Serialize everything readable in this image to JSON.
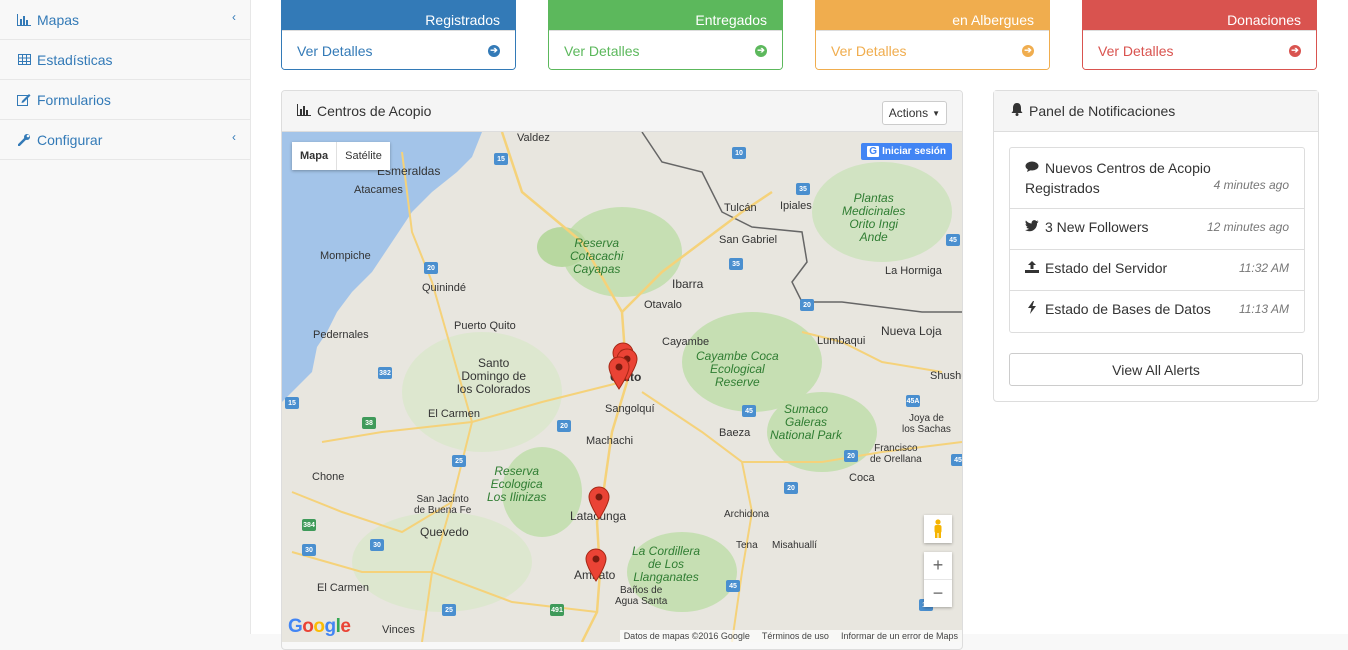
{
  "sidebar": {
    "items": [
      {
        "label": "Mapas",
        "icon": "bar-chart-icon",
        "has_submenu": true
      },
      {
        "label": "Estadísticas",
        "icon": "table-icon",
        "has_submenu": false
      },
      {
        "label": "Formularios",
        "icon": "edit-icon",
        "has_submenu": false
      },
      {
        "label": "Configurar",
        "icon": "wrench-icon",
        "has_submenu": true
      }
    ]
  },
  "stats": [
    {
      "title": "Registrados",
      "link": "Ver Detalles",
      "color": "#337ab7"
    },
    {
      "title": "Entregados",
      "link": "Ver Detalles",
      "color": "#5cb85c"
    },
    {
      "title": "en Albergues",
      "link": "Ver Detalles",
      "color": "#f0ad4e"
    },
    {
      "title": "Donaciones",
      "link": "Ver Detalles",
      "color": "#d9534f"
    }
  ],
  "map_panel": {
    "title": "Centros de Acopio",
    "actions_label": "Actions",
    "map_types": [
      "Mapa",
      "Satélite"
    ],
    "signin_label": "Iniciar sesión",
    "attribution": [
      "Datos de mapas ©2016 Google",
      "Términos de uso",
      "Informar de un error de Maps"
    ],
    "logo": "Google",
    "labels": {
      "valdez": "Valdez",
      "esmeraldas": "Esmeraldas",
      "atacames": "Atacames",
      "mompiche": "Mompiche",
      "quininde": "Quinindé",
      "puerto_quito": "Puerto Quito",
      "pedernales": "Pedernales",
      "santo_domingo": "Santo\nDomingo de\nlos Colorados",
      "el_carmen_n": "El Carmen",
      "chone": "Chone",
      "san_jacinto": "San Jacinto\nde Buena Fe",
      "quevedo": "Quevedo",
      "el_carmen_s": "El Carmen",
      "vinces": "Vinces",
      "ibarra": "Ibarra",
      "otavalo": "Otavalo",
      "cayambe": "Cayambe",
      "quito": "Quito",
      "sangolqui": "Sangolquí",
      "machachi": "Machachi",
      "latacunga": "Latacunga",
      "ambato": "Ambato",
      "banos": "Baños de\nAgua Santa",
      "tulcan": "Tulcán",
      "ipiales": "Ipiales",
      "san_gabriel": "San Gabriel",
      "la_hormiga": "La Hormiga",
      "nueva_loja": "Nueva Loja",
      "lumbaqui": "Lumbaqui",
      "shushufindi": "Shushufi",
      "baeza": "Baeza",
      "puerto_sachas": "Joya de\nlos Sachas",
      "francisco": "Francisco\nde Orellana",
      "coca": "Coca",
      "archidona": "Archidona",
      "tena": "Tena",
      "misahualli": "Misahuallí",
      "reserva_cotacachi": "Reserva\nCotacachi\nCayapas",
      "cayambe_coca": "Cayambe Coca\nEcological\nReserve",
      "sumaco": "Sumaco\nGaleras\nNational Park",
      "ilinizas": "Reserva\nEcologica\nLos Ilinizas",
      "llanganates": "La Cordillera\nde Los\nLlanganates",
      "plantas": "Plantas\nMedicinales\nOrito Ingi\nAnde"
    },
    "shields": [
      "15",
      "20",
      "35",
      "10",
      "45",
      "382",
      "38",
      "25",
      "384",
      "30",
      "491",
      "45A",
      "20",
      "15",
      "20",
      "25",
      "30",
      "35",
      "45",
      "20",
      "20",
      "45",
      "10",
      "45"
    ]
  },
  "notifications": {
    "title": "Panel de Notificaciones",
    "items": [
      {
        "icon": "comment-icon",
        "text": "Nuevos Centros de Acopio Registrados",
        "time": "4 minutes ago"
      },
      {
        "icon": "twitter-icon",
        "text": "3 New Followers",
        "time": "12 minutes ago"
      },
      {
        "icon": "upload-icon",
        "text": "Estado del Servidor",
        "time": "11:32 AM"
      },
      {
        "icon": "bolt-icon",
        "text": "Estado de Bases de Datos",
        "time": "11:13 AM"
      }
    ],
    "view_all": "View All Alerts"
  }
}
